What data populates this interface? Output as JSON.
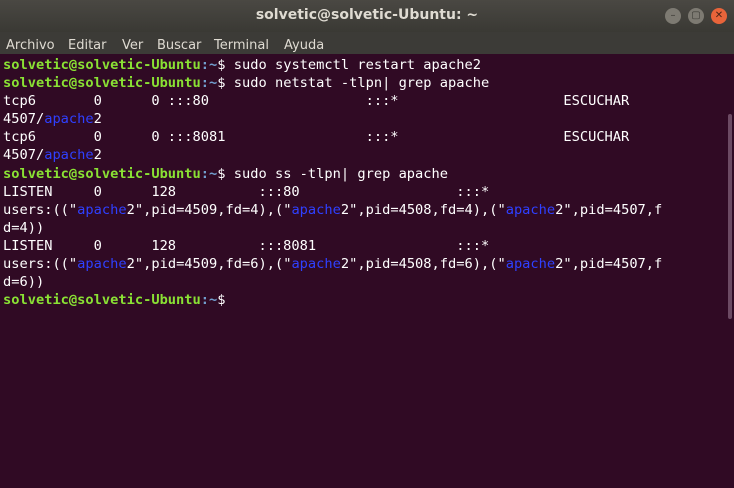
{
  "window": {
    "title": "solvetic@solvetic-Ubuntu: ~",
    "minimize_glyph": "–",
    "maximize_glyph": "▢",
    "close_glyph": "✕"
  },
  "menu": {
    "items": [
      "Archivo",
      "Editar",
      "Ver",
      "Buscar",
      "Terminal",
      "Ayuda"
    ]
  },
  "prompt": {
    "user_host": "solvetic@solvetic-Ubuntu",
    "path": ":~",
    "symbol": "$"
  },
  "lines": [
    {
      "type": "cmd",
      "text": " sudo systemctl restart apache2"
    },
    {
      "type": "cmd",
      "text": " sudo netstat -tlpn| grep apache"
    },
    {
      "type": "out",
      "parts": [
        {
          "t": "tcp6       0      0 :::80                   :::*                    ESCUCHAR"
        }
      ]
    },
    {
      "type": "out",
      "parts": [
        {
          "t": "4507/"
        },
        {
          "t": "apache",
          "hl": true
        },
        {
          "t": "2"
        }
      ]
    },
    {
      "type": "out",
      "parts": [
        {
          "t": "tcp6       0      0 :::8081                 :::*                    ESCUCHAR"
        }
      ]
    },
    {
      "type": "out",
      "parts": [
        {
          "t": "4507/"
        },
        {
          "t": "apache",
          "hl": true
        },
        {
          "t": "2"
        }
      ]
    },
    {
      "type": "cmd",
      "text": " sudo ss -tlpn| grep apache"
    },
    {
      "type": "out",
      "parts": [
        {
          "t": "LISTEN     0      128          :::80                   :::*"
        }
      ]
    },
    {
      "type": "out",
      "parts": [
        {
          "t": "users:((\""
        },
        {
          "t": "apache",
          "hl": true
        },
        {
          "t": "2\",pid=4509,fd=4),(\""
        },
        {
          "t": "apache",
          "hl": true
        },
        {
          "t": "2\",pid=4508,fd=4),(\""
        },
        {
          "t": "apache",
          "hl": true
        },
        {
          "t": "2\",pid=4507,f"
        }
      ]
    },
    {
      "type": "out",
      "parts": [
        {
          "t": "d=4))"
        }
      ]
    },
    {
      "type": "out",
      "parts": [
        {
          "t": "LISTEN     0      128          :::8081                 :::*"
        }
      ]
    },
    {
      "type": "out",
      "parts": [
        {
          "t": "users:((\""
        },
        {
          "t": "apache",
          "hl": true
        },
        {
          "t": "2\",pid=4509,fd=6),(\""
        },
        {
          "t": "apache",
          "hl": true
        },
        {
          "t": "2\",pid=4508,fd=6),(\""
        },
        {
          "t": "apache",
          "hl": true
        },
        {
          "t": "2\",pid=4507,f"
        }
      ]
    },
    {
      "type": "out",
      "parts": [
        {
          "t": "d=6))"
        }
      ]
    },
    {
      "type": "cmd",
      "text": ""
    }
  ],
  "colors": {
    "background": "#300a24",
    "user_host": "#8ae234",
    "path": "#729fcf",
    "highlight": "#2f40ff"
  }
}
